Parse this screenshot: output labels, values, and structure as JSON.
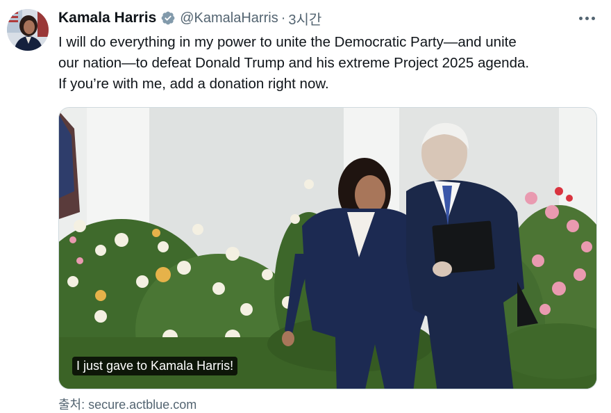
{
  "author": {
    "name": "Kamala Harris",
    "handle": "@KamalaHarris",
    "separator": "·",
    "time": "3시간",
    "verified": true
  },
  "tweet": {
    "lines": [
      "I will do everything in my power to unite the Democratic Party—and unite",
      "our nation—to defeat Donald Trump and his extreme Project 2025 agenda.",
      "If you’re with me, add a donation right now."
    ]
  },
  "media": {
    "caption": "I just gave to Kamala Harris!"
  },
  "link_source": {
    "label": "출처: secure.actblue.com"
  },
  "icons": {
    "verified": "verified-badge-icon",
    "more": "more-options-icon"
  },
  "colors": {
    "text": "#0f1419",
    "secondary": "#536471",
    "verified": "#829aab"
  }
}
